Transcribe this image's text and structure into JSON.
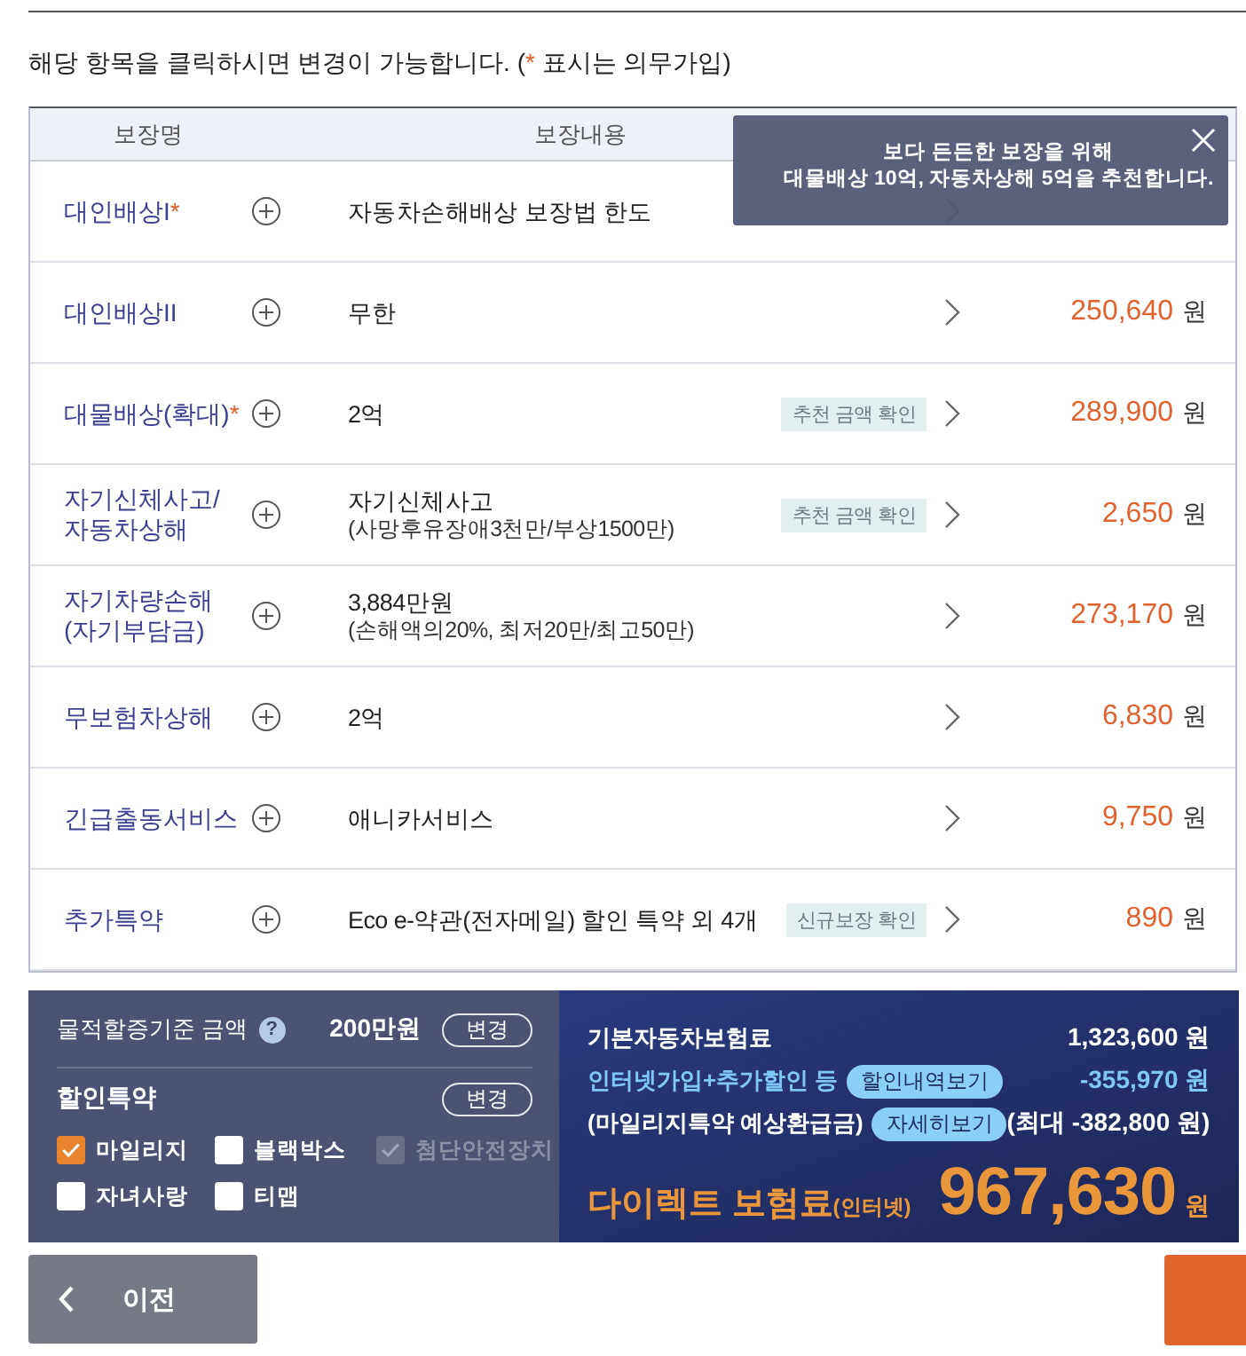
{
  "notice": {
    "before": "해당 항목을 클릭하시면 변경이 가능합니다. (",
    "mark": "*",
    "after": "표시는 의무가입)"
  },
  "table": {
    "columns": [
      "보장명",
      "보장내용"
    ],
    "rows": [
      {
        "name": [
          "대인배상I"
        ],
        "mark": "*",
        "content": [
          "자동차손해배상 보장법 한도"
        ]
      },
      {
        "name": [
          "대인배상II"
        ],
        "content": [
          "무한"
        ],
        "price": "250,640",
        "unit": "원"
      },
      {
        "name": [
          "대물배상(확대)"
        ],
        "mark": "*",
        "content": [
          "2억"
        ],
        "badge": "추천 금액 확인",
        "price": "289,900",
        "unit": "원"
      },
      {
        "name": [
          "자기신체사고/",
          "자동차상해"
        ],
        "content": [
          "자기신체사고",
          "(사망후유장애3천만/부상1500만)"
        ],
        "badge": "추천 금액 확인",
        "price": "2,650",
        "unit": "원"
      },
      {
        "name": [
          "자기차량손해",
          "(자기부담금)"
        ],
        "content": [
          "3,884만원",
          "(손해액의20%, 최저20만/최고50만)"
        ],
        "price": "273,170",
        "unit": "원"
      },
      {
        "name": [
          "무보험차상해"
        ],
        "content": [
          "2억"
        ],
        "price": "6,830",
        "unit": "원"
      },
      {
        "name": [
          "긴급출동서비스"
        ],
        "content": [
          "애니카서비스"
        ],
        "price": "9,750",
        "unit": "원"
      },
      {
        "name": [
          "추가특약"
        ],
        "content": [
          "Eco e-약관(전자메일) 할인 특약 외 4개"
        ],
        "badge": "신규보장 확인",
        "price": "890",
        "unit": "원"
      }
    ]
  },
  "tooltip": {
    "lines": [
      "보다 든든한 보장을 위해",
      "대물배상 10억, 자동차상해 5억을 추천합니다."
    ]
  },
  "options": {
    "threshold": {
      "label": "물적할증기준 금액",
      "help": "?",
      "value": "200만원",
      "button": "변경"
    },
    "discounts": {
      "label": "할인특약",
      "button": "변경",
      "items": [
        {
          "label": "마일리지",
          "checked": true,
          "disabled": false
        },
        {
          "label": "블랙박스",
          "checked": false,
          "disabled": false
        },
        {
          "label": "첨단안전장치",
          "checked": true,
          "disabled": true
        },
        {
          "label": "자녀사랑",
          "checked": false,
          "disabled": false
        },
        {
          "label": "티맵",
          "checked": false,
          "disabled": false
        }
      ]
    }
  },
  "summary": {
    "rows": [
      {
        "kind": "base",
        "label": "기본자동차보험료",
        "value": "1,323,600 원"
      },
      {
        "kind": "discount",
        "label": "인터넷가입+추가할인 등",
        "button": "할인내역보기",
        "value": "-355,970 원"
      },
      {
        "kind": "refund",
        "label": "(마일리지특약 예상환급금)",
        "button": "자세히보기",
        "value": "(최대 -382,800 원)"
      }
    ],
    "total": {
      "label": "다이렉트 보험료",
      "suffix": "(인터넷)",
      "amount": "967,630",
      "unit": "원"
    }
  },
  "buttons": [
    {
      "kind": "back",
      "label": "이전"
    },
    {
      "kind": "primary"
    }
  ]
}
